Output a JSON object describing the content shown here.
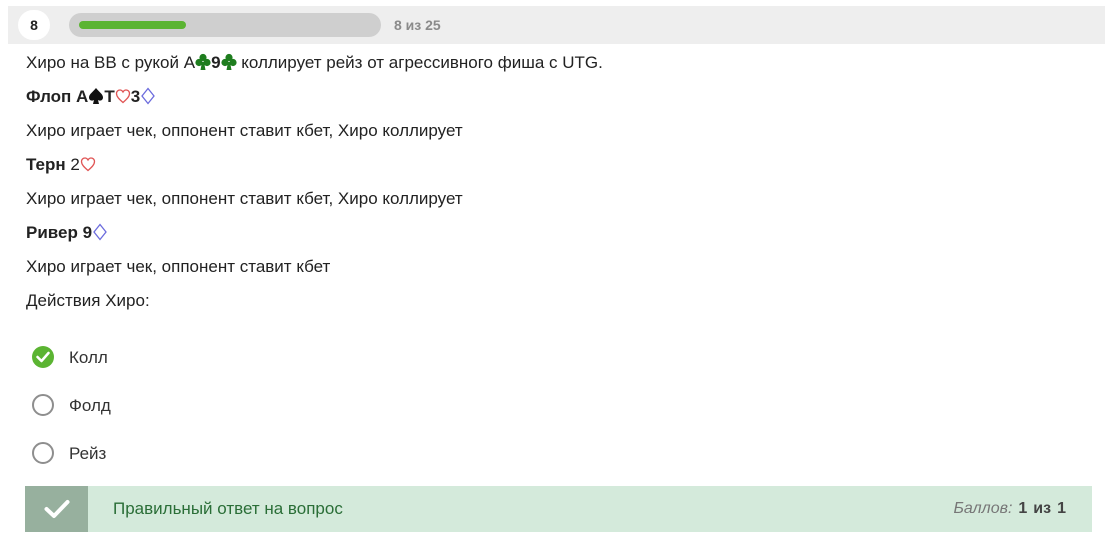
{
  "header": {
    "question_number": "8",
    "progress_text": "8 из 25",
    "progress_fraction": 0.32
  },
  "question": {
    "intro": {
      "t1": "Хиро на BB с рукой A",
      "t2": "9",
      "t3": " коллирует рейз от  агрессивного фиша с UTG."
    },
    "flop": {
      "t1": "Флоп A",
      "t2": "T",
      "t3": "3"
    },
    "flop_action": "Хиро играет чек, оппонент ставит кбет, Хиро коллирует",
    "turn": {
      "label": "Терн",
      "card": "2"
    },
    "turn_action": "Хиро играет чек, оппонент ставит кбет, Хиро коллирует",
    "river": {
      "t1": "Ривер 9"
    },
    "river_action": "Хиро играет чек, оппонент ставит кбет",
    "prompt": "Действия Хиро:"
  },
  "options": [
    {
      "label": "Колл",
      "selected": true
    },
    {
      "label": "Фолд",
      "selected": false
    },
    {
      "label": "Рейз",
      "selected": false
    }
  ],
  "result": {
    "message": "Правильный ответ на вопрос",
    "score_label": "Баллов:",
    "score_value": "1",
    "score_of": "из",
    "score_max": "1"
  },
  "colors": {
    "accent_green": "#5bb432",
    "club_green": "#1e7d1e",
    "heart_red": "#e05555",
    "diamond_blue": "#6b6bdd"
  },
  "icons": [
    "club-icon",
    "spade-icon",
    "heart-icon",
    "diamond-icon",
    "check-icon"
  ]
}
